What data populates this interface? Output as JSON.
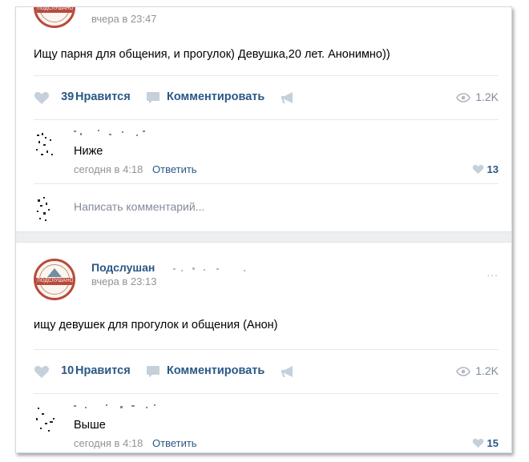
{
  "posts": [
    {
      "author": "",
      "time": "вчера в 23:47",
      "text": "Ищу парня для общения, и прогулок) Девушка,20 лет. Анонимно))",
      "like_label": "Нравится",
      "likes": "39",
      "comment_label": "Комментировать",
      "views": "1.2K",
      "reply": {
        "text": "Ниже",
        "time": "сегодня в 4:18",
        "reply_label": "Ответить",
        "likes": "13"
      },
      "write_placeholder": "Написать комментарий..."
    },
    {
      "author": "Подслушан",
      "time": "вчера в 23:13",
      "text": "ищу девушек для прогулок и общения (Анон)",
      "like_label": "Нравится",
      "likes": "10",
      "comment_label": "Комментировать",
      "views": "1.2K",
      "reply": {
        "text": "Выше",
        "time": "сегодня в 4:18",
        "reply_label": "Ответить",
        "likes": "15"
      }
    }
  ],
  "logo_text": "ПОДСЛУШАНО",
  "more_icon": "...",
  "colors": {
    "link": "#2a5885",
    "meta": "#939393",
    "icon": "#c5d0db",
    "separator": "#edeef0",
    "logo": "#b84a3c"
  }
}
